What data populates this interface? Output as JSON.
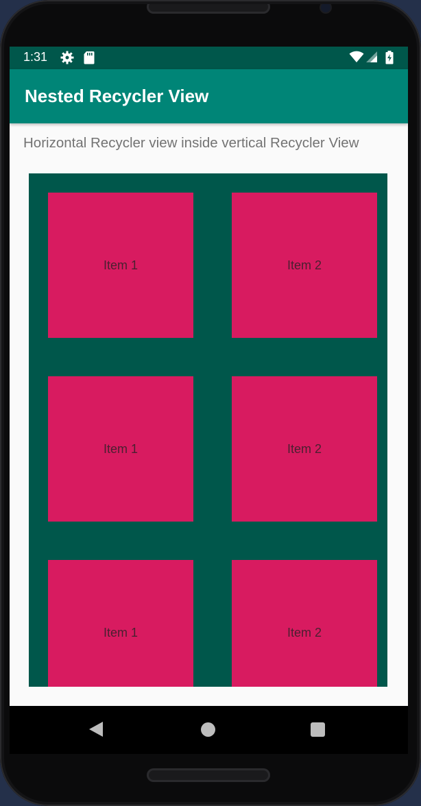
{
  "status_bar": {
    "time": "1:31",
    "icons": [
      "settings-icon",
      "sd-card-icon",
      "wifi-icon",
      "signal-icon",
      "battery-icon"
    ]
  },
  "app_bar": {
    "title": "Nested Recycler View"
  },
  "subtitle": "Horizontal Recycler view inside vertical Recycler View",
  "rows": [
    {
      "items": [
        {
          "label": "Item 1"
        },
        {
          "label": "Item 2"
        }
      ]
    },
    {
      "items": [
        {
          "label": "Item 1"
        },
        {
          "label": "Item 2"
        }
      ]
    },
    {
      "items": [
        {
          "label": "Item 1"
        },
        {
          "label": "Item 2"
        }
      ]
    }
  ],
  "nav_bar": {
    "buttons": [
      "back-icon",
      "home-icon",
      "recents-icon"
    ]
  },
  "colors": {
    "primary": "#008577",
    "primary_dark": "#00574b",
    "accent": "#D81B60"
  }
}
